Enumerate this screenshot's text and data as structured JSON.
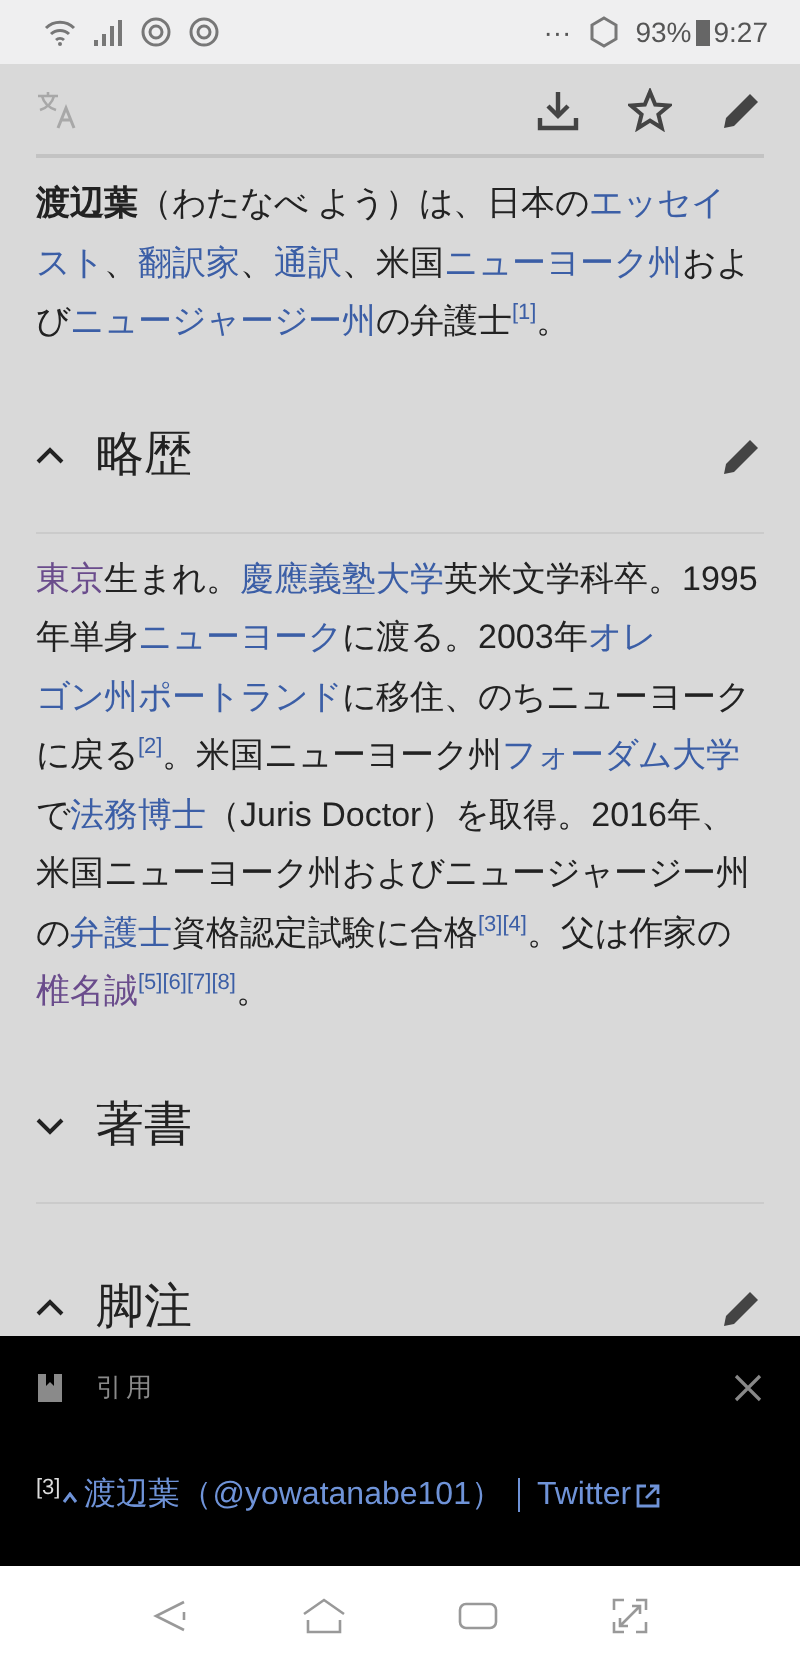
{
  "status_bar": {
    "dots": "···",
    "battery": "93%",
    "time": "9:27"
  },
  "lead": [
    {
      "kind": "bold",
      "text": "渡辺葉"
    },
    {
      "kind": "text",
      "text": "（わたなべ よう）は、日本の"
    },
    {
      "kind": "link",
      "text": "エッセイ"
    },
    {
      "kind": "link",
      "text": "スト"
    },
    {
      "kind": "text",
      "text": "、"
    },
    {
      "kind": "link",
      "text": "翻訳家"
    },
    {
      "kind": "text",
      "text": "、"
    },
    {
      "kind": "link",
      "text": "通訳"
    },
    {
      "kind": "text",
      "text": "、米国"
    },
    {
      "kind": "link",
      "text": "ニューヨーク州"
    },
    {
      "kind": "text",
      "text": "および"
    },
    {
      "kind": "link",
      "text": "ニュージャージー州"
    },
    {
      "kind": "text",
      "text": "の弁護士"
    },
    {
      "kind": "ref",
      "text": "[1]"
    },
    {
      "kind": "text",
      "text": "。"
    }
  ],
  "sections": [
    {
      "title": "略歴",
      "expanded": true,
      "editable": true,
      "paragraph": [
        {
          "kind": "visited",
          "text": "東京"
        },
        {
          "kind": "text",
          "text": "生まれ。"
        },
        {
          "kind": "link",
          "text": "慶應義塾大学"
        },
        {
          "kind": "text",
          "text": "英米文学科卒。1995年単身"
        },
        {
          "kind": "link",
          "text": "ニューヨーク"
        },
        {
          "kind": "text",
          "text": "に渡る。2003年"
        },
        {
          "kind": "link",
          "text": "オレ"
        },
        {
          "kind": "link",
          "text": "ゴン州ポートランド"
        },
        {
          "kind": "text",
          "text": "に移住、のちニューヨークに戻る"
        },
        {
          "kind": "ref",
          "text": "[2]"
        },
        {
          "kind": "text",
          "text": "。米国ニューヨーク州"
        },
        {
          "kind": "link",
          "text": "フォーダム"
        },
        {
          "kind": "link",
          "text": "大学"
        },
        {
          "kind": "text",
          "text": "で"
        },
        {
          "kind": "link",
          "text": "法務博士"
        },
        {
          "kind": "text",
          "text": "（Juris Doctor）を取得。2016年、米国ニューヨーク州およびニュージャージー州の"
        },
        {
          "kind": "link",
          "text": "弁護士"
        },
        {
          "kind": "text",
          "text": "資格認定試験に合格"
        },
        {
          "kind": "ref",
          "text": "[3]"
        },
        {
          "kind": "ref",
          "text": "[4]"
        },
        {
          "kind": "text",
          "text": "。父は作家の"
        },
        {
          "kind": "visited",
          "text": "椎名誠"
        },
        {
          "kind": "ref",
          "text": "[5]"
        },
        {
          "kind": "ref",
          "text": "[6]"
        },
        {
          "kind": "ref",
          "text": "[7]"
        },
        {
          "kind": "ref",
          "text": "[8]"
        },
        {
          "kind": "text",
          "text": "。"
        }
      ]
    },
    {
      "title": "著書",
      "expanded": false,
      "editable": false
    },
    {
      "title": "脚注",
      "expanded": true,
      "editable": true
    }
  ],
  "citation_panel": {
    "title": "引用",
    "ref": "[3]",
    "source": "渡辺葉（@yowatanabe101）",
    "site": "Twitter"
  }
}
